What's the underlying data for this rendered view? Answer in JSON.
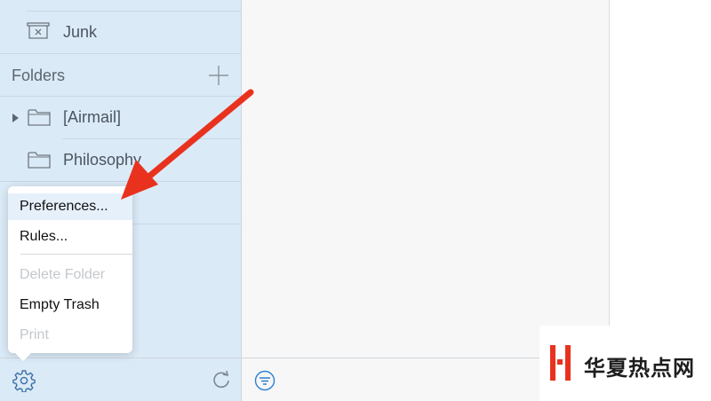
{
  "sidebar": {
    "junk_label": "Junk",
    "folders_header": "Folders",
    "folders": [
      {
        "label": "[Airmail]",
        "expandable": true
      },
      {
        "label": "Philosophy",
        "expandable": false
      }
    ]
  },
  "menu": {
    "items": [
      {
        "label": "Preferences...",
        "enabled": true,
        "highlighted": true
      },
      {
        "label": "Rules...",
        "enabled": true
      },
      {
        "label": "Delete Folder",
        "enabled": false
      },
      {
        "label": "Empty Trash",
        "enabled": true
      },
      {
        "label": "Print",
        "enabled": false
      }
    ]
  },
  "toolbar": {
    "settings_icon": "gear-icon",
    "refresh_icon": "refresh-icon",
    "filter_icon": "filter-icon"
  },
  "annotation": {
    "arrow_color": "#e8321e"
  },
  "watermark": {
    "text": "华夏热点网",
    "brand_color": "#e8321e"
  },
  "colors": {
    "sidebar_bg": "#dbeaf7",
    "accent": "#2a7fd4"
  }
}
